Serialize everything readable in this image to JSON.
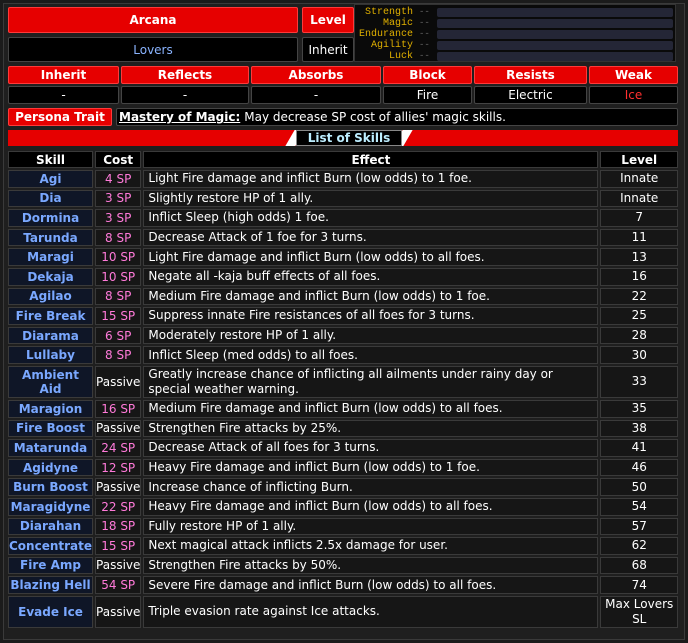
{
  "header": {
    "arcana_label": "Arcana",
    "arcana_value": "Lovers",
    "level_label": "Level",
    "level_value": "Inherit"
  },
  "stats": [
    {
      "label": "Strength",
      "value": "--"
    },
    {
      "label": "Magic",
      "value": "--"
    },
    {
      "label": "Endurance",
      "value": "--"
    },
    {
      "label": "Agility",
      "value": "--"
    },
    {
      "label": "Luck",
      "value": "--"
    }
  ],
  "affinities": {
    "headers": [
      "Inherit",
      "Reflects",
      "Absorbs",
      "Block",
      "Resists",
      "Weak"
    ],
    "values": [
      "-",
      "-",
      "-",
      "Fire",
      "Electric",
      "Ice"
    ]
  },
  "trait": {
    "label": "Persona Trait",
    "name": "Mastery of Magic:",
    "description": "May decrease SP cost of allies' magic skills."
  },
  "skills_title": "List of Skills",
  "columns": [
    "Skill",
    "Cost",
    "Effect",
    "Level"
  ],
  "skills": [
    {
      "name": "Agi",
      "cost": "4 SP",
      "effect": "Light Fire damage and inflict Burn (low odds) to 1 foe.",
      "level": "Innate"
    },
    {
      "name": "Dia",
      "cost": "3 SP",
      "effect": "Slightly restore HP of 1 ally.",
      "level": "Innate"
    },
    {
      "name": "Dormina",
      "cost": "3 SP",
      "effect": "Inflict Sleep (high odds) 1 foe.",
      "level": "7"
    },
    {
      "name": "Tarunda",
      "cost": "8 SP",
      "effect": "Decrease Attack of 1 foe for 3 turns.",
      "level": "11"
    },
    {
      "name": "Maragi",
      "cost": "10 SP",
      "effect": "Light Fire damage and inflict Burn (low odds) to all foes.",
      "level": "13"
    },
    {
      "name": "Dekaja",
      "cost": "10 SP",
      "effect": "Negate all -kaja buff effects of all foes.",
      "level": "16"
    },
    {
      "name": "Agilao",
      "cost": "8 SP",
      "effect": "Medium Fire damage and inflict Burn (low odds) to 1 foe.",
      "level": "22"
    },
    {
      "name": "Fire Break",
      "cost": "15 SP",
      "effect": "Suppress innate Fire resistances of all foes for 3 turns.",
      "level": "25"
    },
    {
      "name": "Diarama",
      "cost": "6 SP",
      "effect": "Moderately restore HP of 1 ally.",
      "level": "28"
    },
    {
      "name": "Lullaby",
      "cost": "8 SP",
      "effect": "Inflict Sleep (med odds) to all foes.",
      "level": "30"
    },
    {
      "name": "Ambient Aid",
      "cost": "Passive",
      "effect": "Greatly increase chance of inflicting all ailments under rainy day or special weather warning.",
      "level": "33"
    },
    {
      "name": "Maragion",
      "cost": "16 SP",
      "effect": "Medium Fire damage and inflict Burn (low odds) to all foes.",
      "level": "35"
    },
    {
      "name": "Fire Boost",
      "cost": "Passive",
      "effect": "Strengthen Fire attacks by 25%.",
      "level": "38"
    },
    {
      "name": "Matarunda",
      "cost": "24 SP",
      "effect": "Decrease Attack of all foes for 3 turns.",
      "level": "41"
    },
    {
      "name": "Agidyne",
      "cost": "12 SP",
      "effect": "Heavy Fire damage and inflict Burn (low odds) to 1 foe.",
      "level": "46"
    },
    {
      "name": "Burn Boost",
      "cost": "Passive",
      "effect": "Increase chance of inflicting Burn.",
      "level": "50"
    },
    {
      "name": "Maragidyne",
      "cost": "22 SP",
      "effect": "Heavy Fire damage and inflict Burn (low odds) to all foes.",
      "level": "54"
    },
    {
      "name": "Diarahan",
      "cost": "18 SP",
      "effect": "Fully restore HP of 1 ally.",
      "level": "57"
    },
    {
      "name": "Concentrate",
      "cost": "15 SP",
      "effect": "Next magical attack inflicts 2.5x damage for user.",
      "level": "62"
    },
    {
      "name": "Fire Amp",
      "cost": "Passive",
      "effect": "Strengthen Fire attacks by 50%.",
      "level": "68"
    },
    {
      "name": "Blazing Hell",
      "cost": "54 SP",
      "effect": "Severe Fire damage and inflict Burn (low odds) to all foes.",
      "level": "74"
    },
    {
      "name": "Evade Ice",
      "cost": "Passive",
      "effect": "Triple evasion rate against Ice attacks.",
      "level": "Max Lovers SL"
    }
  ],
  "colors": {
    "accent": "#e60000",
    "skill_name": "#7aa8ff",
    "sp_cost": "#ff7ad9",
    "weak": "#ff3030",
    "stat_label": "#e0b000"
  }
}
